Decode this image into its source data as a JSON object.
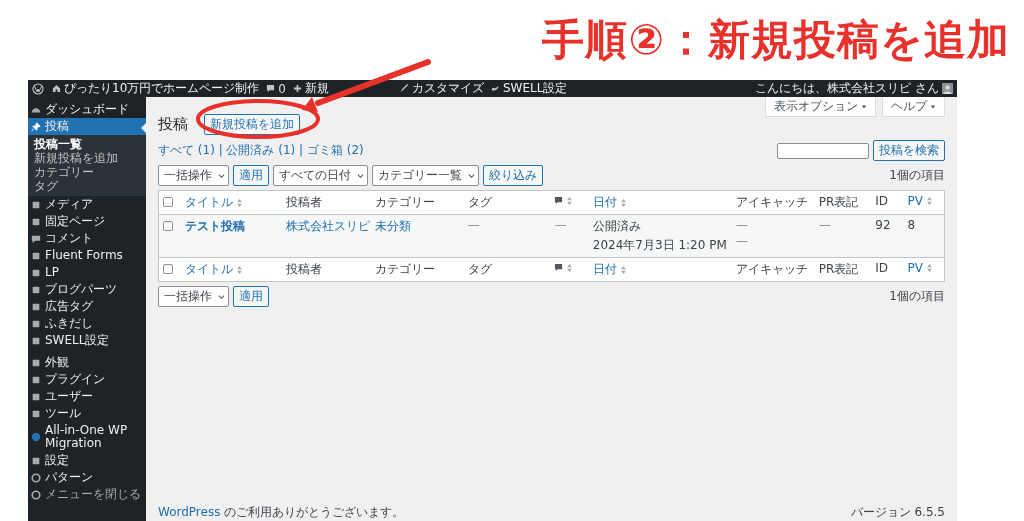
{
  "annotation": {
    "heading": "手順②：新規投稿を追加"
  },
  "admin_bar": {
    "site_name": "ぴったり10万円でホームページ制作",
    "comments_count": "0",
    "new_label": "新規",
    "items": [
      "カスタマイズ",
      "SWELL設定"
    ],
    "greeting": "こんにちは、株式会社スリピ さん"
  },
  "sidebar": {
    "items": [
      {
        "label": "ダッシュボード",
        "selected": false
      },
      {
        "label": "投稿",
        "selected": true,
        "children": [
          {
            "label": "投稿一覧",
            "selected": true
          },
          {
            "label": "新規投稿を追加",
            "selected": false
          },
          {
            "label": "カテゴリー",
            "selected": false
          },
          {
            "label": "タグ",
            "selected": false
          }
        ]
      },
      {
        "label": "メディア",
        "selected": false
      },
      {
        "label": "固定ページ",
        "selected": false
      },
      {
        "label": "コメント",
        "selected": false
      },
      {
        "label": "Fluent Forms",
        "selected": false
      },
      {
        "label": "LP",
        "selected": false
      },
      {
        "label": "ブログパーツ",
        "selected": false
      },
      {
        "label": "広告タグ",
        "selected": false
      },
      {
        "label": "ふきだし",
        "selected": false
      },
      {
        "label": "SWELL設定",
        "selected": false
      },
      {
        "label": "外観",
        "selected": false
      },
      {
        "label": "プラグイン",
        "selected": false
      },
      {
        "label": "ユーザー",
        "selected": false
      },
      {
        "label": "ツール",
        "selected": false
      },
      {
        "label": "All-in-One WP Migration",
        "selected": false
      },
      {
        "label": "設定",
        "selected": false
      },
      {
        "label": "パターン",
        "selected": false
      },
      {
        "label": "メニューを閉じる",
        "selected": false,
        "kind": "collapse"
      }
    ]
  },
  "screen_tabs": [
    "表示オプション",
    "ヘルプ"
  ],
  "page": {
    "title": "投稿",
    "add_button": "新規投稿を追加",
    "views": "すべて (1) | 公開済み (1) | ゴミ箱 (2)",
    "search_button": "投稿を検索",
    "item_count_top": "1個の項目",
    "item_count_bottom": "1個の項目"
  },
  "filters": {
    "bulk_action": "一括操作",
    "apply": "適用",
    "dates": "すべての日付",
    "categories": "カテゴリー一覧",
    "filter": "絞り込み"
  },
  "bottom_filters": {
    "bulk_action": "一括操作",
    "apply": "適用"
  },
  "table": {
    "select_all_checked": false,
    "footer_select_all_checked": false,
    "columns": [
      {
        "label": "タイトル",
        "sortable": true
      },
      {
        "label": "投稿者",
        "sortable": false
      },
      {
        "label": "カテゴリー",
        "sortable": false
      },
      {
        "label": "タグ",
        "sortable": false
      },
      {
        "kind": "comments",
        "sortable": true
      },
      {
        "label": "日付",
        "sortable": true
      },
      {
        "label": "アイキャッチ",
        "sortable": false
      },
      {
        "label": "PR表記",
        "sortable": false
      },
      {
        "label": "ID",
        "sortable": false
      },
      {
        "label": "PV",
        "sortable": true
      }
    ],
    "footer_columns": [
      {
        "label": "タイトル",
        "sortable": true
      },
      {
        "label": "投稿者",
        "sortable": false
      },
      {
        "label": "カテゴリー",
        "sortable": false
      },
      {
        "label": "タグ",
        "sortable": false
      },
      {
        "kind": "comments",
        "sortable": true
      },
      {
        "label": "日付",
        "sortable": true
      },
      {
        "label": "アイキャッチ",
        "sortable": false
      },
      {
        "label": "PR表記",
        "sortable": false
      },
      {
        "label": "ID",
        "sortable": false
      },
      {
        "label": "PV",
        "sortable": true
      }
    ],
    "rows": [
      {
        "checked": false,
        "title": "テスト投稿",
        "author": "株式会社スリピ",
        "category": "未分類",
        "tags": "—",
        "comments": "—",
        "status": "公開済み",
        "date": "2024年7月3日 1:20 PM",
        "eyecatch": [
          "—",
          "—"
        ],
        "pr": "—",
        "id": "92",
        "pv": "8"
      }
    ]
  },
  "footer": {
    "thanks_link": "WordPress",
    "thanks_text": "のご利用ありがとうございます。",
    "version": "バージョン 6.5.5"
  }
}
